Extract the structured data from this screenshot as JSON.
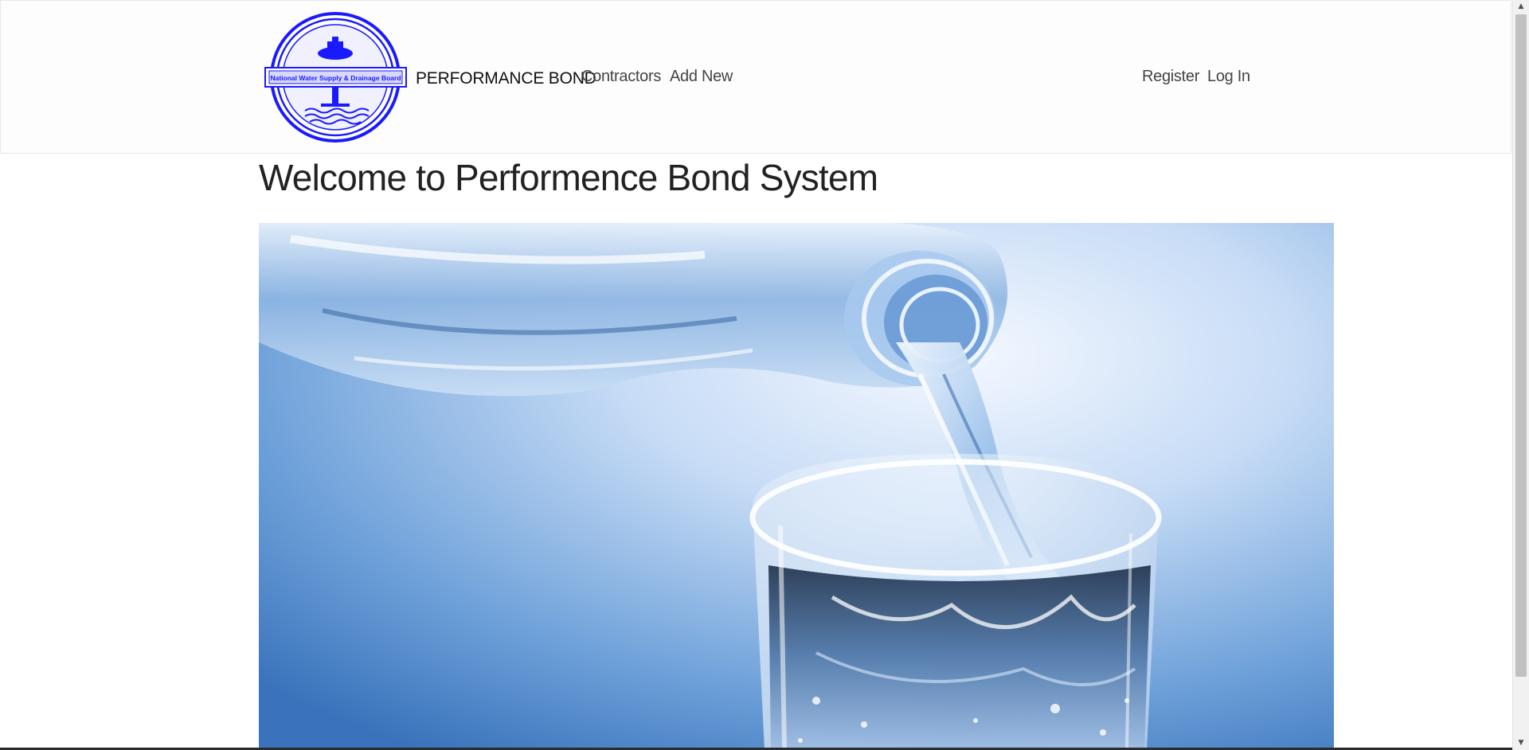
{
  "navbar": {
    "logo_text": "National Water Supply & Drainage Board",
    "brand": "PERFORMANCE BOND",
    "links": [
      {
        "label": "Contractors"
      },
      {
        "label": "Add New"
      }
    ],
    "account_links": [
      {
        "label": "Register"
      },
      {
        "label": "Log In"
      }
    ]
  },
  "main": {
    "title": "Welcome to Performence Bond System",
    "hero_image": "water-pouring-image"
  },
  "colors": {
    "logo_blue": "#1a1aff",
    "hero_background": "#5b90d4"
  },
  "scrollbar": {
    "up_icon": "scroll-up-arrow-icon",
    "down_icon": "scroll-down-arrow-icon"
  }
}
